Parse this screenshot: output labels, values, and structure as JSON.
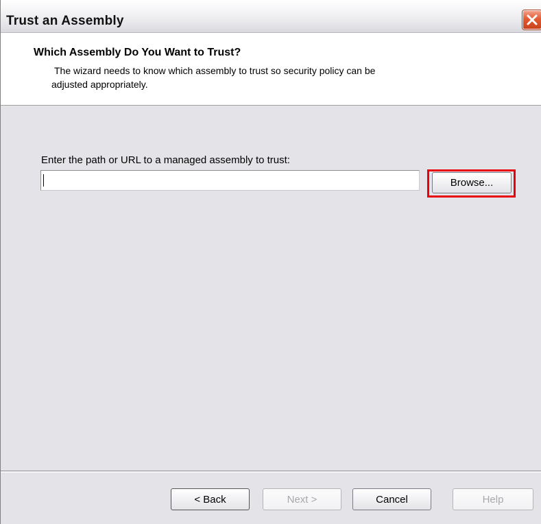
{
  "window": {
    "title": "Trust an Assembly",
    "close_icon": "close-icon"
  },
  "header": {
    "title": "Which Assembly Do You Want to Trust?",
    "description_line1": "The wizard needs to know which assembly to trust so security policy can be",
    "description_line2": "adjusted appropriately."
  },
  "form": {
    "path_label": "Enter the path or URL to a managed assembly to trust:",
    "path_value": "",
    "browse_label": "Browse...",
    "highlight_color": "#e8000a"
  },
  "footer": {
    "back_label": "< Back",
    "next_label": "Next >",
    "cancel_label": "Cancel",
    "help_label": "Help"
  }
}
